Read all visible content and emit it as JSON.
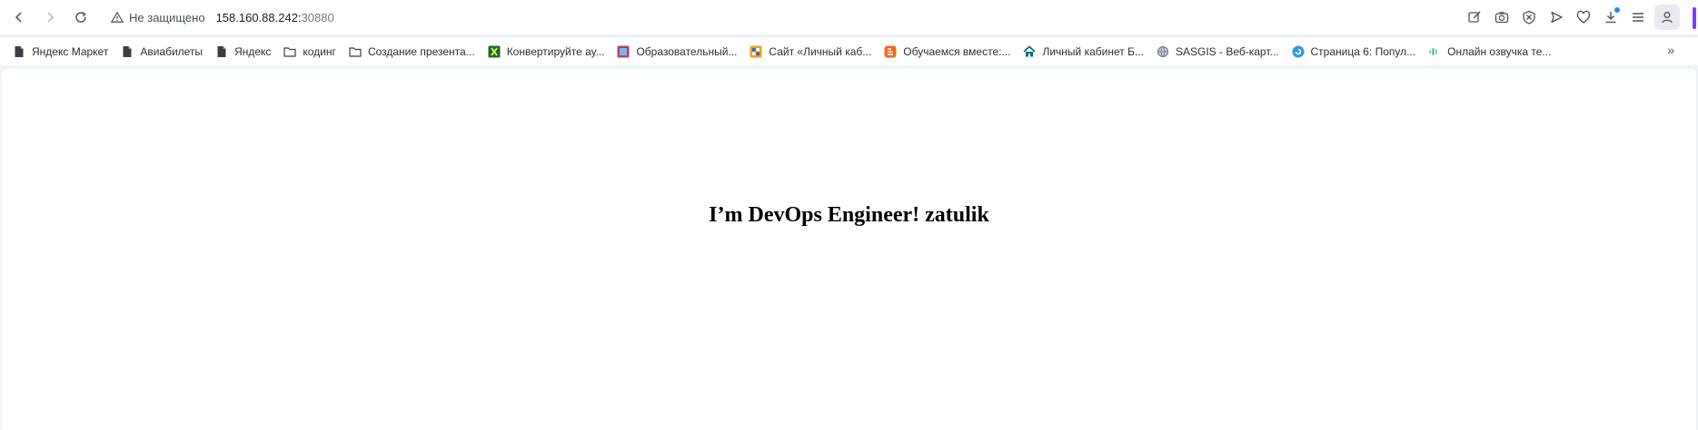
{
  "address_bar": {
    "security_label": "Не защищено",
    "url_host": "158.160.88.242:",
    "url_port": "30880"
  },
  "bookmarks": [
    {
      "label": "Яндекс Маркет",
      "icon": "page-icon"
    },
    {
      "label": "Авиабилеты",
      "icon": "page-icon"
    },
    {
      "label": "Яндекс",
      "icon": "page-icon"
    },
    {
      "label": "кодинг",
      "icon": "folder-icon"
    },
    {
      "label": "Создание презента...",
      "icon": "folder-icon"
    },
    {
      "label": "Конвертируйте ау...",
      "icon": "green-x-icon"
    },
    {
      "label": "Образовательный...",
      "icon": "portal-icon"
    },
    {
      "label": "Сайт «Личный каб...",
      "icon": "orange-grid-icon"
    },
    {
      "label": "Обучаемся вместе:...",
      "icon": "blogger-icon"
    },
    {
      "label": "Личный кабинет Б...",
      "icon": "house-icon"
    },
    {
      "label": "SASGIS - Веб-карт...",
      "icon": "globe-icon"
    },
    {
      "label": "Страница 6: Попул...",
      "icon": "blue-circle-icon"
    },
    {
      "label": "Онлайн озвучка те...",
      "icon": "sound-icon"
    }
  ],
  "page": {
    "headline": "I’m DevOps Engineer! zatulik"
  },
  "colors": {
    "accent": "#7b3cff",
    "download_dot": "#1a8cff"
  }
}
